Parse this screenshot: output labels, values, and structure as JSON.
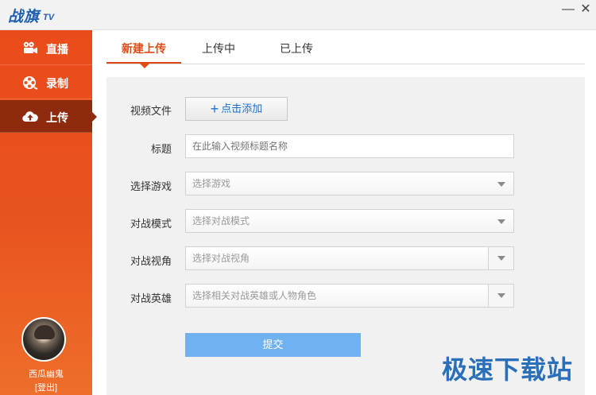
{
  "app": {
    "logo_text": "战旗",
    "logo_tv": "TV",
    "minimize_glyph": "—",
    "close_glyph": "✕"
  },
  "sidebar": {
    "items": [
      {
        "label": "直播",
        "icon": "video-camera-icon"
      },
      {
        "label": "录制",
        "icon": "film-reel-icon"
      },
      {
        "label": "上传",
        "icon": "cloud-upload-icon"
      }
    ],
    "active_index": 2,
    "user": {
      "name": "西瓜幽鬼",
      "logout_label": "[登出]"
    }
  },
  "tabs": [
    {
      "label": "新建上传",
      "active": true
    },
    {
      "label": "上传中",
      "active": false
    },
    {
      "label": "已上传",
      "active": false
    }
  ],
  "form": {
    "video_file_label": "视频文件",
    "add_button_label": "点击添加",
    "title_label": "标题",
    "title_placeholder": "在此输入视频标题名称",
    "game_label": "选择游戏",
    "game_placeholder": "选择游戏",
    "mode_label": "对战模式",
    "mode_placeholder": "选择对战模式",
    "view_label": "对战视角",
    "view_placeholder": "选择对战视角",
    "hero_label": "对战英雄",
    "hero_placeholder": "选择相关对战英雄或人物角色",
    "submit_label": "提交"
  },
  "watermark": "极速下载站",
  "colors": {
    "accent": "#e04a15",
    "sidebar_active": "#8e2a0e",
    "submit": "#6fb2ef",
    "link_blue": "#1a6fd1"
  }
}
